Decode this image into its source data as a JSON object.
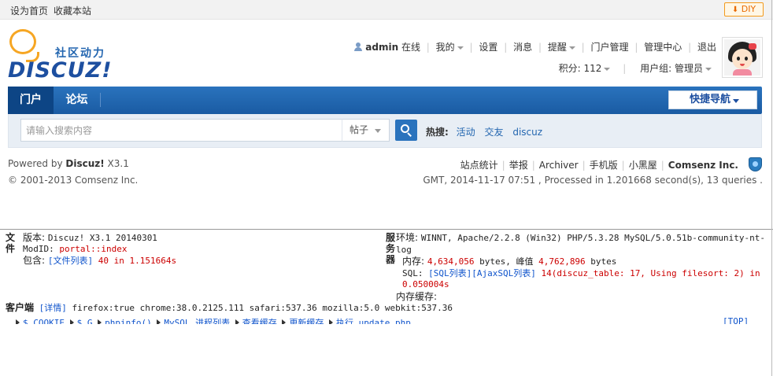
{
  "topbar": {
    "set_home": "设为首页",
    "bookmark": "收藏本站",
    "diy": "DIY"
  },
  "header": {
    "slogan": "社区动力",
    "brand": "DISCUZ!",
    "user": {
      "username": "admin",
      "online": "在线",
      "my": "我的",
      "settings": "设置",
      "messages": "消息",
      "reminders": "提醒",
      "portal_manage": "门户管理",
      "admin_center": "管理中心",
      "logout": "退出",
      "credits": "积分: 112",
      "usergroup": "用户组: 管理员"
    }
  },
  "nav": {
    "tabs": [
      "门户",
      "论坛"
    ],
    "active": 0,
    "quick_nav": "快捷导航"
  },
  "search": {
    "placeholder": "请输入搜索内容",
    "type": "帖子",
    "hot_label": "热搜:",
    "hot_keywords": [
      "活动",
      "交友",
      "discuz"
    ]
  },
  "footer": {
    "powered_prefix": "Powered by ",
    "powered_brand": "Discuz!",
    "powered_version": " X3.1",
    "copyright": "© 2001-2013 Comsenz Inc.",
    "links": [
      "站点统计",
      "举报",
      "Archiver",
      "手机版",
      "小黑屋"
    ],
    "company": "Comsenz Inc.",
    "timing": "GMT, 2014-11-17 07:51 , Processed in 1.201668 second(s), 13 queries ."
  },
  "debug": {
    "file_label": "文件",
    "version_label": "版本: ",
    "version_value": "Discuz! X3.1 20140301",
    "modid_label": "ModID: ",
    "modid_value": "portal::index",
    "include_label": "包含: ",
    "include_link": "[文件列表]",
    "include_value": " 40 in 1.151664s",
    "server_label": "服务器",
    "env_label": "环境: ",
    "env_value": "WINNT, Apache/2.2.8 (Win32) PHP/5.3.28 MySQL/5.0.51b-community-nt-log",
    "memory_label": "内存: ",
    "memory_value": "4,634,056",
    "memory_mid": " bytes, 峰值 ",
    "memory_peak": "4,762,896",
    "memory_unit": " bytes",
    "sql_label": "SQL: ",
    "sql_link1": "[SQL列表]",
    "sql_link2": "[AjaxSQL列表]",
    "sql_value": " 14(discuz_table: 17, Using filesort: 2) in 0.050004s",
    "cache_label": "内存缓存:",
    "client_label": "客户端",
    "client_link": "[详情]",
    "client_value": " firefox:true chrome:38.0.2125.111 safari:537.36 mozilla:5.0 webkit:537.36",
    "links": [
      "$_COOKIE",
      "$_G",
      "phpinfo()",
      "MySQL 进程列表",
      "查看缓存",
      "更新缓存",
      "执行 update.php"
    ],
    "top": "[TOP]"
  }
}
